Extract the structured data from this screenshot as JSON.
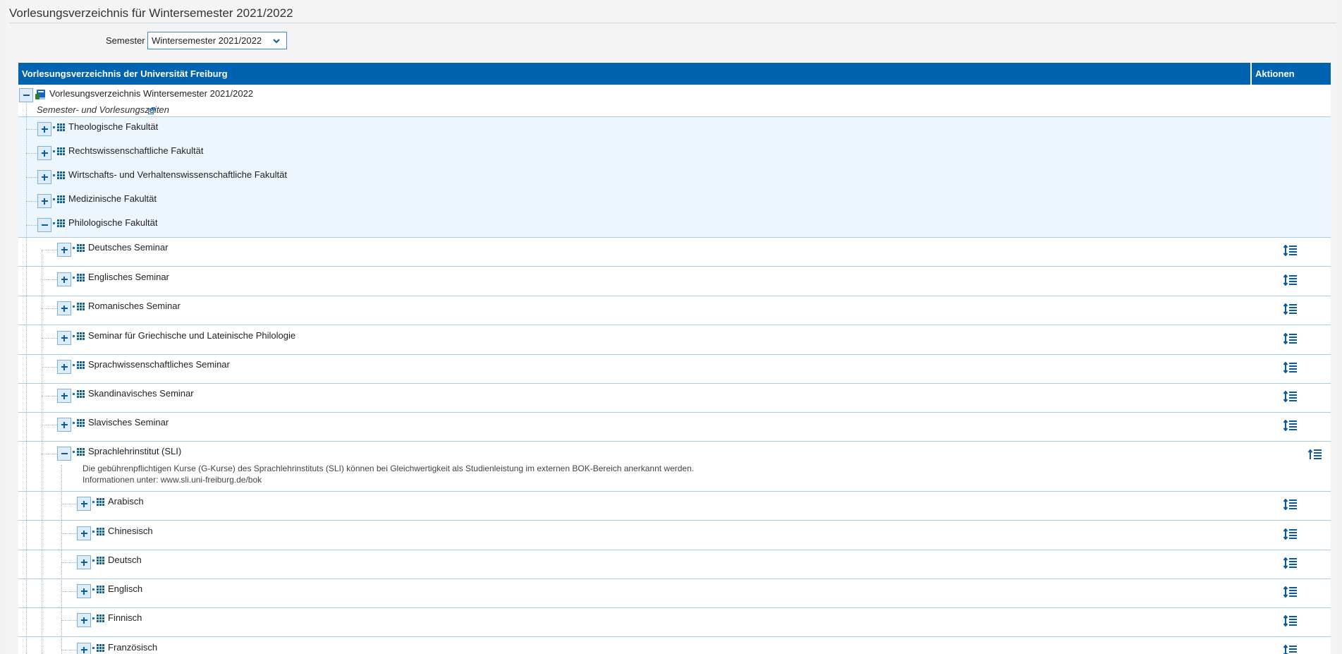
{
  "page": {
    "title": "Vorlesungsverzeichnis für Wintersemester 2021/2022",
    "semester_label": "Semester",
    "semester_value": "Wintersemester 2021/2022"
  },
  "table": {
    "header_title": "Vorlesungsverzeichnis der Universität Freiburg",
    "header_actions": "Aktionen"
  },
  "tree": {
    "root_label": "Vorlesungsverzeichnis Wintersemester 2021/2022",
    "root_link": "Semester- und Vorlesungszeiten",
    "faculties": [
      "Theologische Fakultät",
      "Rechtswissenschaftliche Fakultät",
      "Wirtschafts- und Verhaltenswissenschaftliche Fakultät",
      "Medizinische Fakultät",
      "Philologische Fakultät"
    ],
    "seminars": [
      "Deutsches Seminar",
      "Englisches Seminar",
      "Romanisches Seminar",
      "Seminar für Griechische und Lateinische Philologie",
      "Sprachwissenschaftliches Seminar",
      "Skandinavisches Seminar",
      "Slavisches Seminar",
      "Sprachlehrinstitut (SLI)"
    ],
    "sli_note_line1": "Die gebührenpflichtigen Kurse (G-Kurse) des Sprachlehrinstituts (SLI) können bei Gleichwertigkeit als Studienleistung im externen BOK-Bereich anerkannt werden.",
    "sli_note_line2_prefix": "Informationen unter: ",
    "sli_note_link": "www.sli.uni-freiburg.de/bok",
    "languages": [
      "Arabisch",
      "Chinesisch",
      "Deutsch",
      "Englisch",
      "Finnisch",
      "Französisch"
    ]
  },
  "colors": {
    "header_bg": "#0063af",
    "accent": "#0a5a9c",
    "row_border": "#a9cde9",
    "faculty_row_bg": "#eef6fd"
  },
  "icons": {
    "root": "book-icon",
    "node": "tree-structure-icon",
    "expand": "plus-icon",
    "collapse": "minus-icon",
    "external": "external-link-icon",
    "action_expand": "expand-all-icon",
    "action_collapse": "collapse-all-icon",
    "select": "chevron-down-icon"
  }
}
